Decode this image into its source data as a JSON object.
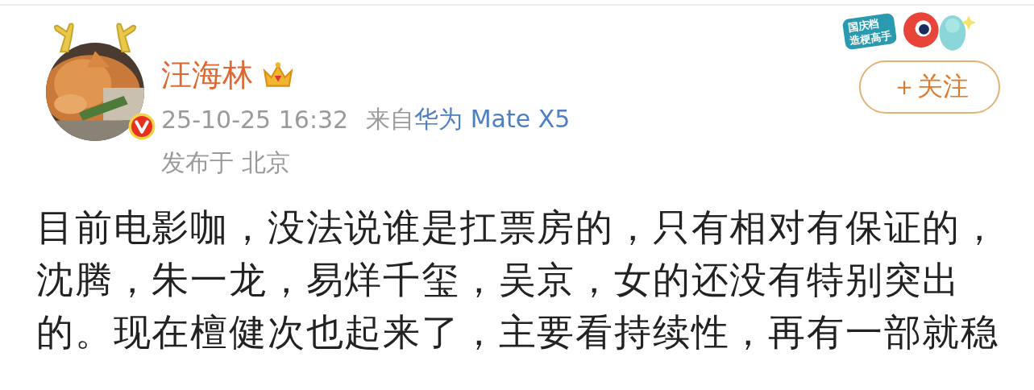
{
  "post": {
    "author": {
      "name": "汪海林",
      "verified": true,
      "crown": true
    },
    "time": "25-10-25 16:32",
    "source_prefix": "来自",
    "source": "华为 Mate X5",
    "location": "发布于 北京",
    "sticker": {
      "lines": [
        "国庆档",
        "造梗高手"
      ]
    },
    "follow_button": "＋关注",
    "text": "目前电影咖，没法说谁是扛票房的，只有相对有保证的，沈腾，朱一龙，易烊千玺，吴京，女的还没有特别突出的。现在檀健次也起来了，主要看持续性，再有一部就稳"
  }
}
